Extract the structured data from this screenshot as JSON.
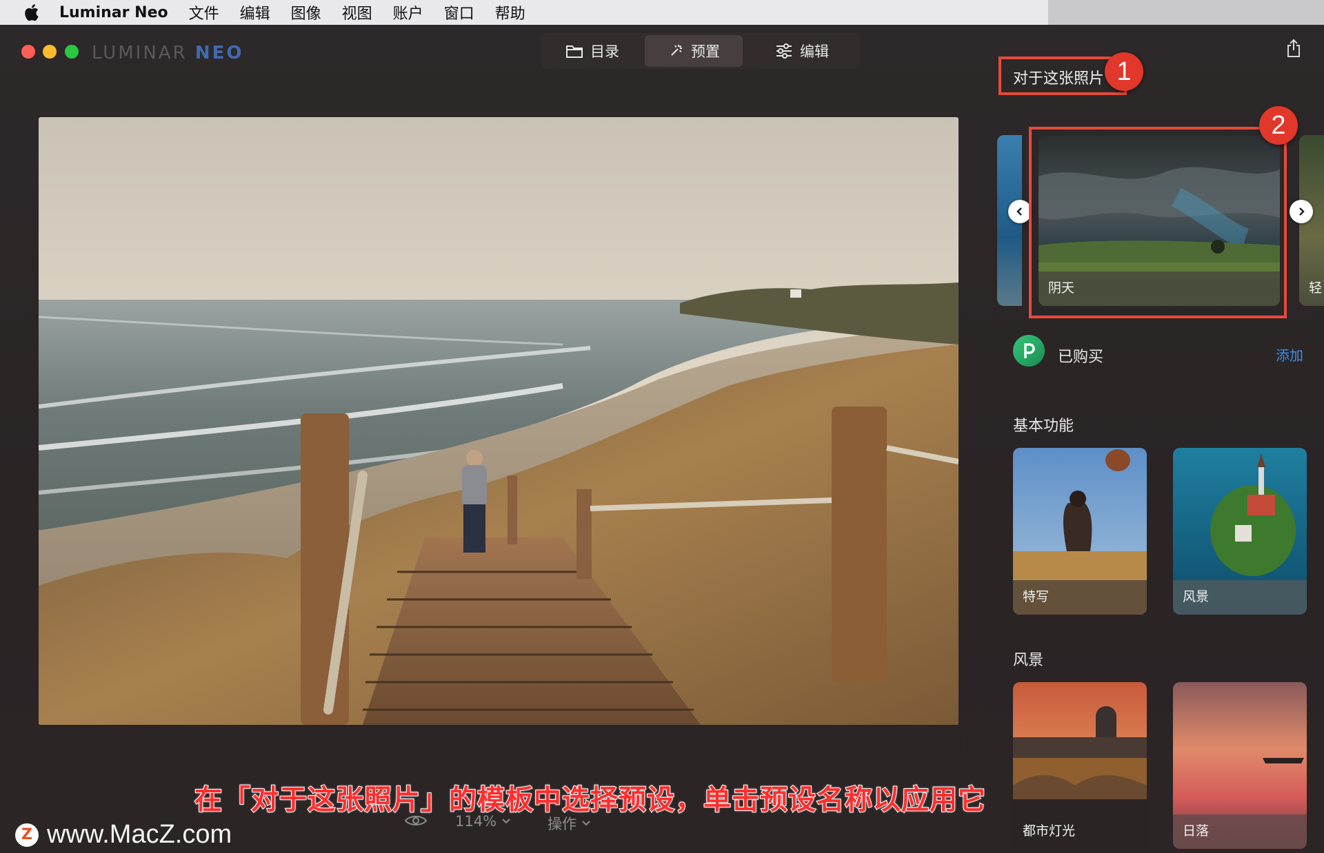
{
  "menubar": {
    "app_name": "Luminar Neo",
    "items": [
      "文件",
      "编辑",
      "图像",
      "视图",
      "账户",
      "窗口",
      "帮助"
    ]
  },
  "window": {
    "logo_primary": "LUMINAR",
    "logo_secondary": "NEO",
    "tabs": [
      {
        "label": "目录",
        "icon": "folder-icon"
      },
      {
        "label": "预置",
        "icon": "magic-wand-icon",
        "active": true
      },
      {
        "label": "编辑",
        "icon": "sliders-icon"
      }
    ]
  },
  "right_panel": {
    "about_title": "对于这张照片",
    "badge_1": "1",
    "badge_2": "2",
    "featured_preset": "阴天",
    "next_preset_partial": "轻",
    "purchased_label": "已购买",
    "add_label": "添加",
    "section_basic": "基本功能",
    "basic_presets": [
      "特写",
      "风景"
    ],
    "section_landscape": "风景",
    "landscape_presets": [
      "都市灯光",
      "日落"
    ]
  },
  "bottom": {
    "zoom": "114%",
    "actions": "操作",
    "caption": "在「对于这张照片」的模板中选择预设，单击预设名称以应用它",
    "watermark_letter": "Z",
    "watermark": "www.MacZ.com"
  },
  "colors": {
    "highlight": "#e84a3a",
    "accent_link": "#3d8ee8",
    "panel_bg": "#2a2425"
  }
}
